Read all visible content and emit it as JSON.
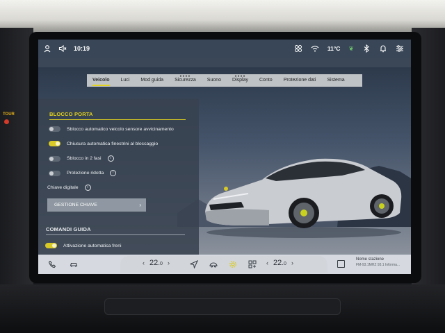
{
  "status_bar": {
    "time": "10:19",
    "temperature": "11°C",
    "icons": [
      "profile-icon",
      "volume-mute-icon",
      "connectivity-icon",
      "wifi-icon",
      "leaf-icon",
      "bluetooth-icon",
      "bell-icon",
      "settings-sliders-icon"
    ]
  },
  "tabs": [
    {
      "label": "Veicolo",
      "active": true
    },
    {
      "label": "Luci"
    },
    {
      "label": "Mod guida"
    },
    {
      "label": "Sicurezza"
    },
    {
      "label": "Suono"
    },
    {
      "label": "Display"
    },
    {
      "label": "Conto"
    },
    {
      "label": "Protezione dati"
    },
    {
      "label": "Sistema"
    }
  ],
  "blocco_porta": {
    "title": "BLOCCO PORTA",
    "items": [
      {
        "label": "Sblocco automatico veicolo sensore avvicinamento",
        "on": false
      },
      {
        "label": "Chiusura automatica finestrini al bloccaggio",
        "on": true
      },
      {
        "label": "Sblocco in 2 fasi",
        "on": false,
        "info": true
      },
      {
        "label": "Protezione ridotta",
        "on": false,
        "info": true
      }
    ],
    "chiave_label": "Chiave digitale",
    "chiave_button": "GESTIONE CHIAVE"
  },
  "comandi_guida": {
    "title": "COMANDI GUIDA",
    "items": [
      {
        "label": "Attivazione automatica freni",
        "on": true
      }
    ]
  },
  "dock": {
    "left_temp": {
      "whole": "22",
      "decimal": "0"
    },
    "right_temp": {
      "whole": "22",
      "decimal": "0"
    },
    "radio_name": "Nome stazione",
    "radio_info": "FM-93.1MHZ 93.1  Informa..."
  },
  "environment": {
    "tour_label": "TOUR"
  },
  "colors": {
    "accent": "#e3d21d",
    "panel": "#384250",
    "dock": "#e4e7eb"
  }
}
